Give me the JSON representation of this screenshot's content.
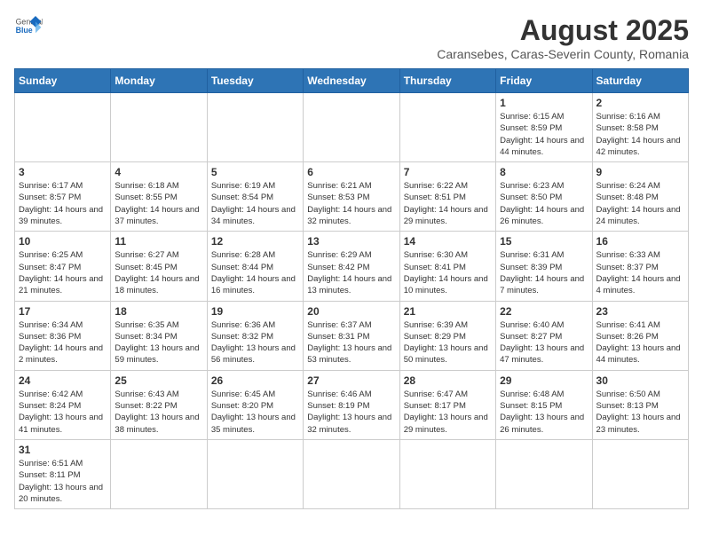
{
  "header": {
    "logo_general": "General",
    "logo_blue": "Blue",
    "month_title": "August 2025",
    "subtitle": "Caransebes, Caras-Severin County, Romania"
  },
  "weekdays": [
    "Sunday",
    "Monday",
    "Tuesday",
    "Wednesday",
    "Thursday",
    "Friday",
    "Saturday"
  ],
  "weeks": [
    [
      {
        "day": "",
        "info": ""
      },
      {
        "day": "",
        "info": ""
      },
      {
        "day": "",
        "info": ""
      },
      {
        "day": "",
        "info": ""
      },
      {
        "day": "",
        "info": ""
      },
      {
        "day": "1",
        "info": "Sunrise: 6:15 AM\nSunset: 8:59 PM\nDaylight: 14 hours and 44 minutes."
      },
      {
        "day": "2",
        "info": "Sunrise: 6:16 AM\nSunset: 8:58 PM\nDaylight: 14 hours and 42 minutes."
      }
    ],
    [
      {
        "day": "3",
        "info": "Sunrise: 6:17 AM\nSunset: 8:57 PM\nDaylight: 14 hours and 39 minutes."
      },
      {
        "day": "4",
        "info": "Sunrise: 6:18 AM\nSunset: 8:55 PM\nDaylight: 14 hours and 37 minutes."
      },
      {
        "day": "5",
        "info": "Sunrise: 6:19 AM\nSunset: 8:54 PM\nDaylight: 14 hours and 34 minutes."
      },
      {
        "day": "6",
        "info": "Sunrise: 6:21 AM\nSunset: 8:53 PM\nDaylight: 14 hours and 32 minutes."
      },
      {
        "day": "7",
        "info": "Sunrise: 6:22 AM\nSunset: 8:51 PM\nDaylight: 14 hours and 29 minutes."
      },
      {
        "day": "8",
        "info": "Sunrise: 6:23 AM\nSunset: 8:50 PM\nDaylight: 14 hours and 26 minutes."
      },
      {
        "day": "9",
        "info": "Sunrise: 6:24 AM\nSunset: 8:48 PM\nDaylight: 14 hours and 24 minutes."
      }
    ],
    [
      {
        "day": "10",
        "info": "Sunrise: 6:25 AM\nSunset: 8:47 PM\nDaylight: 14 hours and 21 minutes."
      },
      {
        "day": "11",
        "info": "Sunrise: 6:27 AM\nSunset: 8:45 PM\nDaylight: 14 hours and 18 minutes."
      },
      {
        "day": "12",
        "info": "Sunrise: 6:28 AM\nSunset: 8:44 PM\nDaylight: 14 hours and 16 minutes."
      },
      {
        "day": "13",
        "info": "Sunrise: 6:29 AM\nSunset: 8:42 PM\nDaylight: 14 hours and 13 minutes."
      },
      {
        "day": "14",
        "info": "Sunrise: 6:30 AM\nSunset: 8:41 PM\nDaylight: 14 hours and 10 minutes."
      },
      {
        "day": "15",
        "info": "Sunrise: 6:31 AM\nSunset: 8:39 PM\nDaylight: 14 hours and 7 minutes."
      },
      {
        "day": "16",
        "info": "Sunrise: 6:33 AM\nSunset: 8:37 PM\nDaylight: 14 hours and 4 minutes."
      }
    ],
    [
      {
        "day": "17",
        "info": "Sunrise: 6:34 AM\nSunset: 8:36 PM\nDaylight: 14 hours and 2 minutes."
      },
      {
        "day": "18",
        "info": "Sunrise: 6:35 AM\nSunset: 8:34 PM\nDaylight: 13 hours and 59 minutes."
      },
      {
        "day": "19",
        "info": "Sunrise: 6:36 AM\nSunset: 8:32 PM\nDaylight: 13 hours and 56 minutes."
      },
      {
        "day": "20",
        "info": "Sunrise: 6:37 AM\nSunset: 8:31 PM\nDaylight: 13 hours and 53 minutes."
      },
      {
        "day": "21",
        "info": "Sunrise: 6:39 AM\nSunset: 8:29 PM\nDaylight: 13 hours and 50 minutes."
      },
      {
        "day": "22",
        "info": "Sunrise: 6:40 AM\nSunset: 8:27 PM\nDaylight: 13 hours and 47 minutes."
      },
      {
        "day": "23",
        "info": "Sunrise: 6:41 AM\nSunset: 8:26 PM\nDaylight: 13 hours and 44 minutes."
      }
    ],
    [
      {
        "day": "24",
        "info": "Sunrise: 6:42 AM\nSunset: 8:24 PM\nDaylight: 13 hours and 41 minutes."
      },
      {
        "day": "25",
        "info": "Sunrise: 6:43 AM\nSunset: 8:22 PM\nDaylight: 13 hours and 38 minutes."
      },
      {
        "day": "26",
        "info": "Sunrise: 6:45 AM\nSunset: 8:20 PM\nDaylight: 13 hours and 35 minutes."
      },
      {
        "day": "27",
        "info": "Sunrise: 6:46 AM\nSunset: 8:19 PM\nDaylight: 13 hours and 32 minutes."
      },
      {
        "day": "28",
        "info": "Sunrise: 6:47 AM\nSunset: 8:17 PM\nDaylight: 13 hours and 29 minutes."
      },
      {
        "day": "29",
        "info": "Sunrise: 6:48 AM\nSunset: 8:15 PM\nDaylight: 13 hours and 26 minutes."
      },
      {
        "day": "30",
        "info": "Sunrise: 6:50 AM\nSunset: 8:13 PM\nDaylight: 13 hours and 23 minutes."
      }
    ],
    [
      {
        "day": "31",
        "info": "Sunrise: 6:51 AM\nSunset: 8:11 PM\nDaylight: 13 hours and 20 minutes."
      },
      {
        "day": "",
        "info": ""
      },
      {
        "day": "",
        "info": ""
      },
      {
        "day": "",
        "info": ""
      },
      {
        "day": "",
        "info": ""
      },
      {
        "day": "",
        "info": ""
      },
      {
        "day": "",
        "info": ""
      }
    ]
  ]
}
